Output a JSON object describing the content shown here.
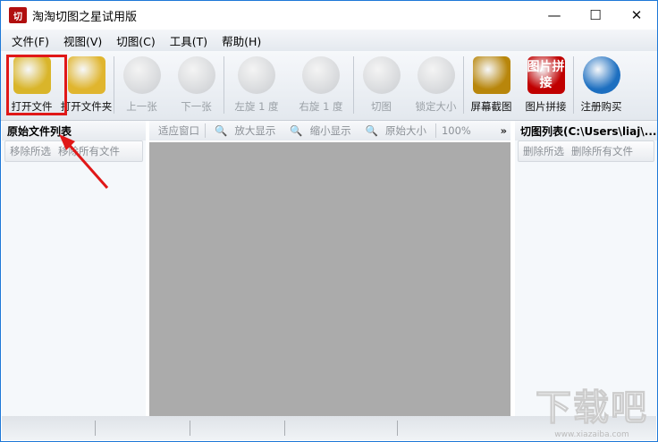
{
  "window": {
    "title": "淘淘切图之星试用版",
    "logo": "切",
    "minimize": "—",
    "maximize": "☐",
    "close": "✕"
  },
  "menu": [
    "文件(F)",
    "视图(V)",
    "切图(C)",
    "工具(T)",
    "帮助(H)"
  ],
  "toolbar": [
    {
      "label": "打开文件",
      "icon": "open-file-icon",
      "enabled": true,
      "color": "#d9b52a"
    },
    {
      "label": "打开文件夹",
      "icon": "open-folder-icon",
      "enabled": true,
      "color": "#e0b52e"
    },
    {
      "label": "上一张",
      "icon": "previous-icon",
      "enabled": false,
      "color": "#c9ccd0"
    },
    {
      "label": "下一张",
      "icon": "next-icon",
      "enabled": false,
      "color": "#c9ccd0"
    },
    {
      "label": "左旋 1 度",
      "icon": "rotate-left-icon",
      "enabled": false,
      "color": "#c9ccd0"
    },
    {
      "label": "右旋 1 度",
      "icon": "rotate-right-icon",
      "enabled": false,
      "color": "#c9ccd0"
    },
    {
      "label": "切图",
      "icon": "scissors-icon",
      "enabled": false,
      "color": "#c9ccd0"
    },
    {
      "label": "锁定大小",
      "icon": "lock-icon",
      "enabled": false,
      "color": "#c9ccd0"
    },
    {
      "label": "屏幕截图",
      "icon": "screenshot-icon",
      "enabled": true,
      "color": "#b8860b"
    },
    {
      "label": "图片拼接",
      "icon": "image-stitch-icon",
      "enabled": true,
      "color": "#c00000",
      "icon_text": "图片拼接"
    },
    {
      "label": "注册购买",
      "icon": "globe-icon",
      "enabled": true,
      "color": "#1d6fc0"
    }
  ],
  "left_panel": {
    "title": "原始文件列表",
    "buttons": [
      "移除所选",
      "移除所有文件"
    ]
  },
  "view_bar": {
    "items": [
      "适应窗口",
      "放大显示",
      "缩小显示",
      "原始大小"
    ],
    "zoom": "100%",
    "more": "»"
  },
  "right_panel": {
    "title": "切图列表(C:\\Users\\liaj\\...",
    "buttons": [
      "删除所选",
      "删除所有文件"
    ]
  },
  "watermark": {
    "big": "下载吧",
    "small": "www.xiazaiba.com"
  }
}
